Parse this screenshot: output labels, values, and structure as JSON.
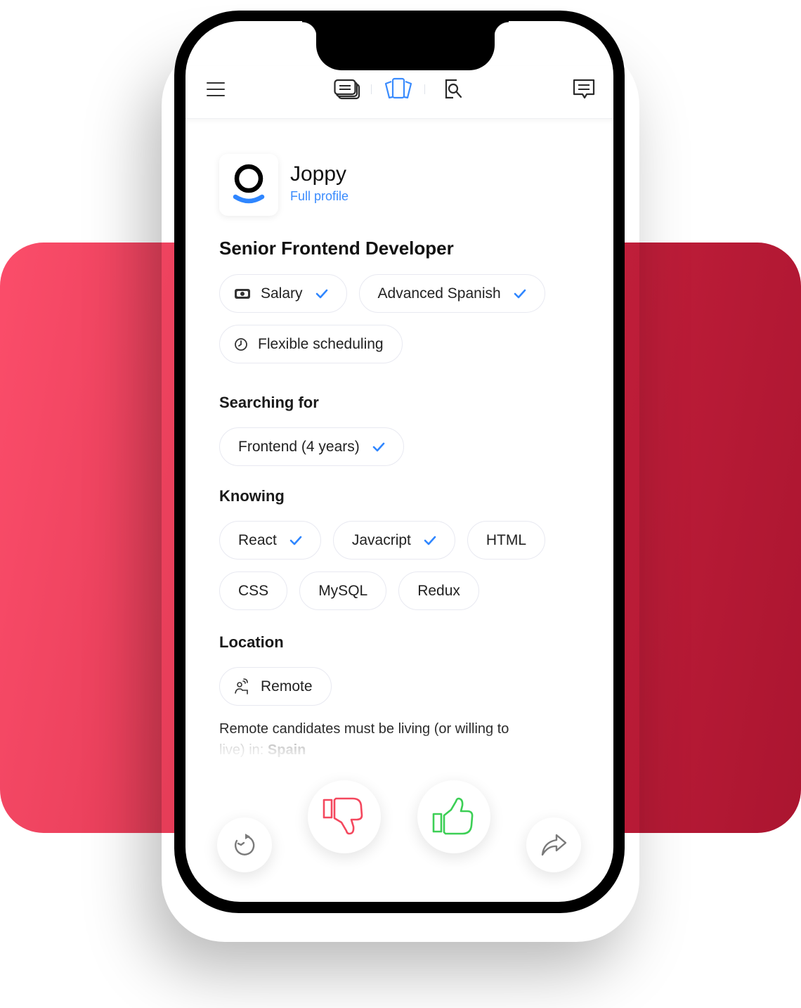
{
  "colors": {
    "accent": "#3a8bfd",
    "dislike": "#f4485e",
    "like": "#3ccf55",
    "background_card_start": "#fb4d6a",
    "background_card_end": "#ab1530"
  },
  "topbar": {
    "menu_icon": "hamburger-menu-icon",
    "tabs": [
      {
        "icon": "stacked-cards-icon",
        "active": false
      },
      {
        "icon": "swipe-cards-icon",
        "active": true
      },
      {
        "icon": "search-document-icon",
        "active": false
      }
    ],
    "messages_icon": "chat-message-icon"
  },
  "company": {
    "name": "Joppy",
    "profile_link": "Full profile"
  },
  "job": {
    "title": "Senior Frontend Developer",
    "perks": [
      {
        "label": "Salary",
        "icon": "money-icon",
        "checked": true
      },
      {
        "label": "Advanced Spanish",
        "icon": null,
        "checked": true
      },
      {
        "label": "Flexible scheduling",
        "icon": "clock-icon",
        "checked": false
      }
    ]
  },
  "searching_for": {
    "title": "Searching for",
    "items": [
      {
        "label": "Frontend (4 years)",
        "checked": true
      }
    ]
  },
  "knowing": {
    "title": "Knowing",
    "items": [
      {
        "label": "React",
        "checked": true
      },
      {
        "label": "Javacript",
        "checked": true
      },
      {
        "label": "HTML",
        "checked": false
      },
      {
        "label": "CSS",
        "checked": false
      },
      {
        "label": "MySQL",
        "checked": false
      },
      {
        "label": "Redux",
        "checked": false
      }
    ]
  },
  "location": {
    "title": "Location",
    "chip": {
      "label": "Remote",
      "icon": "remote-worker-icon"
    },
    "note_prefix": "Remote candidates must be living (or willing to",
    "note_line2": "live) in: ",
    "note_country": "Spain"
  },
  "actions": {
    "undo": "undo-icon",
    "dislike": "thumbs-down-icon",
    "like": "thumbs-up-icon",
    "share": "share-icon"
  }
}
